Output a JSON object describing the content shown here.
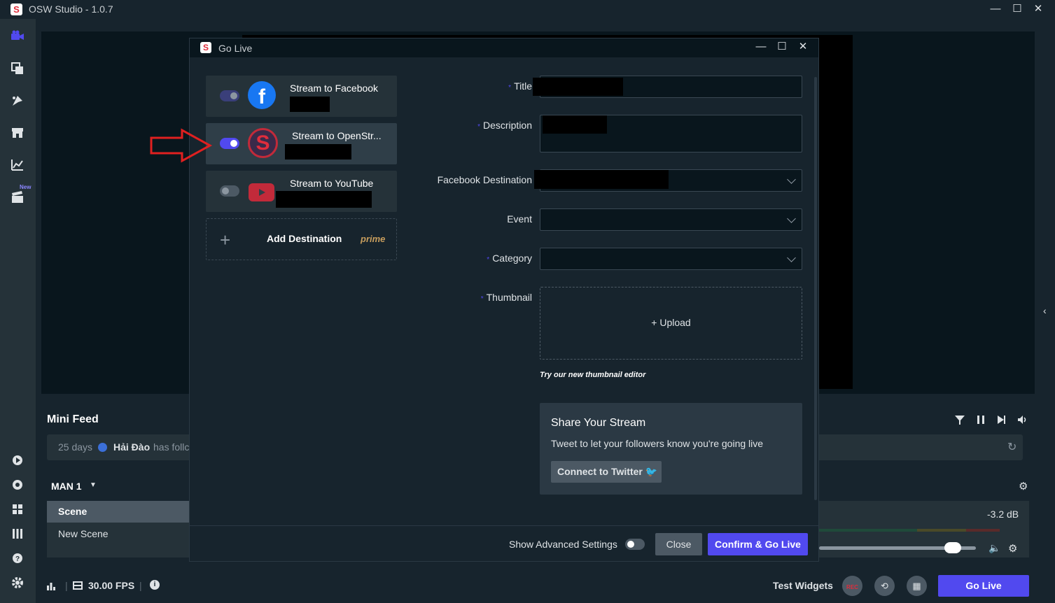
{
  "app": {
    "title": "OSW Studio - 1.0.7",
    "minimize": "—",
    "maximize": "☐",
    "close": "✕"
  },
  "sidebar": {
    "new_badge": "New"
  },
  "mini_feed": {
    "title": "Mini Feed",
    "event": {
      "time": "25 days",
      "user": "Hải Đào",
      "text": "has follc"
    }
  },
  "scenes": {
    "collection": "MAN 1",
    "header": "Scene",
    "items": [
      "New Scene"
    ]
  },
  "mixer": {
    "db": "-3.2 dB"
  },
  "footer": {
    "fps": "30.00 FPS",
    "test_widgets": "Test Widgets",
    "rec": "REC",
    "go_live": "Go Live"
  },
  "modal": {
    "title": "Go Live",
    "destinations": [
      {
        "label": "Stream to Facebook",
        "enabled": true,
        "platform": "facebook"
      },
      {
        "label": "Stream to OpenStr...",
        "enabled": true,
        "platform": "openstream"
      },
      {
        "label": "Stream to YouTube",
        "enabled": false,
        "platform": "youtube"
      }
    ],
    "add_destination": "Add Destination",
    "prime": "prime",
    "form": {
      "title_label": "Title",
      "description_label": "Description",
      "fb_destination_label": "Facebook Destination",
      "event_label": "Event",
      "category_label": "Category",
      "thumbnail_label": "Thumbnail",
      "upload": "+ Upload",
      "thumb_editor": "Try our new thumbnail editor",
      "required_mark": "*"
    },
    "share": {
      "title": "Share Your Stream",
      "desc": "Tweet to let your followers know you're going live",
      "button": "Connect to Twitter"
    },
    "advanced_label": "Show Advanced Settings",
    "advanced_enabled": false,
    "close_label": "Close",
    "confirm_label": "Confirm & Go Live"
  },
  "colors": {
    "accent": "#5149ef",
    "annotation": "#e02020",
    "facebook": "#1877f2",
    "youtube": "#e02d3c"
  }
}
